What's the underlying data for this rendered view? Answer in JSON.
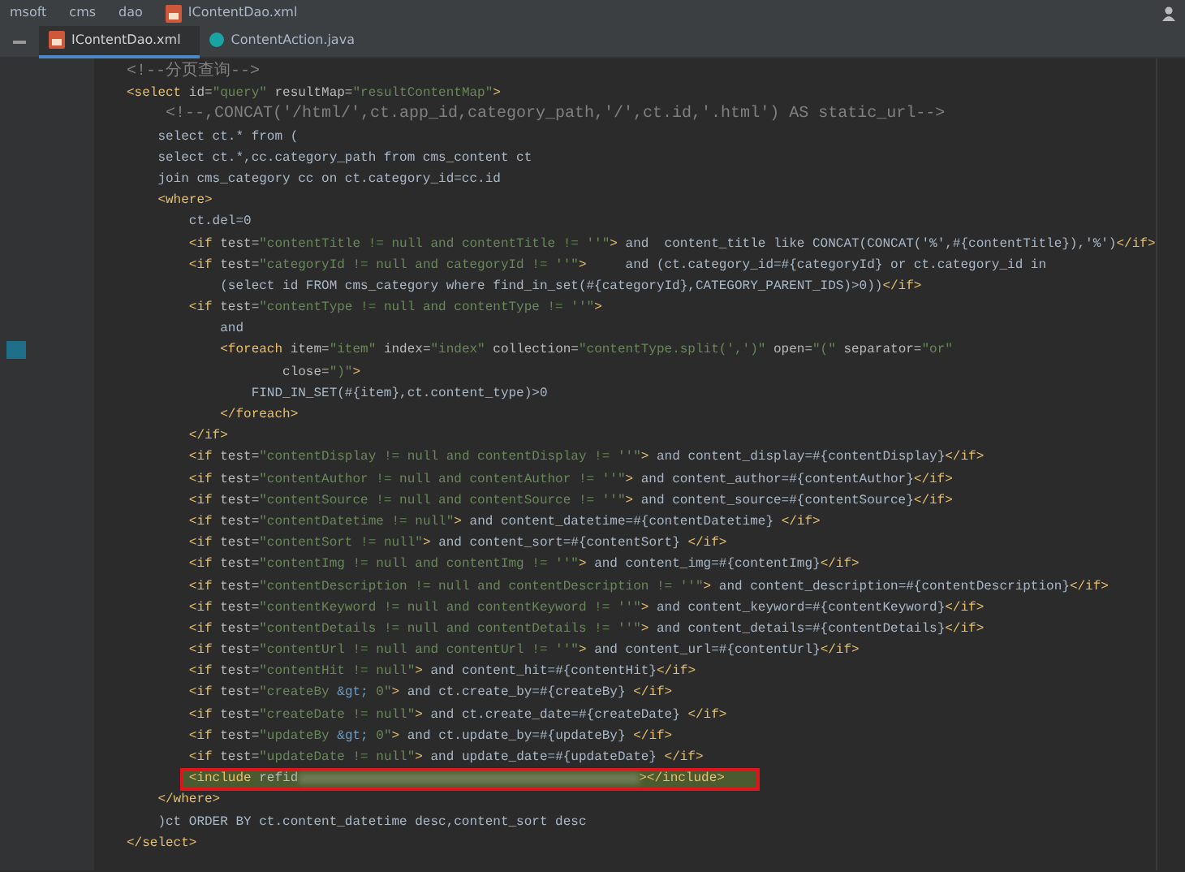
{
  "breadcrumb": [
    {
      "label": "msoft",
      "kind": "folder"
    },
    {
      "label": "cms",
      "kind": "folder"
    },
    {
      "label": "dao",
      "kind": "folder"
    },
    {
      "label": "IContentDao.xml",
      "kind": "file"
    }
  ],
  "tabs": [
    {
      "label": "IContentDao.xml",
      "kind": "xml",
      "selected": true
    },
    {
      "label": "ContentAction.java",
      "kind": "java",
      "selected": false
    }
  ],
  "code_lines": [
    {
      "highlighted": false,
      "marked": false,
      "tokens": [
        {
          "kind": "comment",
          "text": "<!--分页查询-->"
        }
      ]
    },
    {
      "highlighted": false,
      "marked": false,
      "tokens": [
        {
          "kind": "tag",
          "text": "<select"
        },
        {
          "kind": "attr",
          "text": " id="
        },
        {
          "kind": "str",
          "text": "\"query\""
        },
        {
          "kind": "attr",
          "text": " resultMap="
        },
        {
          "kind": "str",
          "text": "\"resultContentMap\""
        },
        {
          "kind": "tag",
          "text": ">"
        }
      ]
    },
    {
      "highlighted": false,
      "marked": false,
      "tokens": [
        {
          "kind": "comment",
          "text": "    <!--,CONCAT('/html/',ct.app_id,category_path,'/',ct.id,'.html') AS static_url-->"
        }
      ]
    },
    {
      "highlighted": false,
      "marked": false,
      "tokens": [
        {
          "kind": "text",
          "text": "    select ct.* from ("
        }
      ]
    },
    {
      "highlighted": false,
      "marked": false,
      "tokens": [
        {
          "kind": "text",
          "text": "    select ct.*,cc.category_path from cms_content ct"
        }
      ]
    },
    {
      "highlighted": false,
      "marked": false,
      "tokens": [
        {
          "kind": "text",
          "text": "    join cms_category cc on ct.category_id=cc.id"
        }
      ]
    },
    {
      "highlighted": false,
      "marked": false,
      "tokens": [
        {
          "kind": "tag",
          "text": "    <where>"
        }
      ]
    },
    {
      "highlighted": false,
      "marked": false,
      "tokens": [
        {
          "kind": "text",
          "text": "        ct.del=0"
        }
      ]
    },
    {
      "highlighted": false,
      "marked": false,
      "tokens": [
        {
          "kind": "tag",
          "text": "        <if"
        },
        {
          "kind": "attr",
          "text": " test="
        },
        {
          "kind": "str",
          "text": "\"contentTitle != null and contentTitle != ''\""
        },
        {
          "kind": "tag",
          "text": ">"
        },
        {
          "kind": "text",
          "text": " and  content_title like CONCAT(CONCAT('%',#{contentTitle}),'%')"
        },
        {
          "kind": "tag",
          "text": "</if>"
        }
      ]
    },
    {
      "highlighted": false,
      "marked": false,
      "tokens": [
        {
          "kind": "tag",
          "text": "        <if"
        },
        {
          "kind": "attr",
          "text": " test="
        },
        {
          "kind": "str",
          "text": "\"categoryId != null and categoryId != ''\""
        },
        {
          "kind": "tag",
          "text": ">"
        },
        {
          "kind": "text",
          "text": "     and (ct.category_id=#{categoryId} or ct.category_id in"
        }
      ]
    },
    {
      "highlighted": false,
      "marked": false,
      "tokens": [
        {
          "kind": "text",
          "text": "            (select id FROM cms_category where find_in_set(#{categoryId},CATEGORY_PARENT_IDS)>0))"
        },
        {
          "kind": "tag",
          "text": "</if>"
        }
      ]
    },
    {
      "highlighted": false,
      "marked": false,
      "tokens": [
        {
          "kind": "tag",
          "text": "        <if"
        },
        {
          "kind": "attr",
          "text": " test="
        },
        {
          "kind": "str",
          "text": "\"contentType != null and contentType != ''\""
        },
        {
          "kind": "tag",
          "text": ">"
        }
      ]
    },
    {
      "highlighted": false,
      "marked": false,
      "tokens": [
        {
          "kind": "text",
          "text": "            and"
        }
      ]
    },
    {
      "highlighted": false,
      "marked": true,
      "tokens": [
        {
          "kind": "tag",
          "text": "            <foreach"
        },
        {
          "kind": "attr",
          "text": " item="
        },
        {
          "kind": "str",
          "text": "\"item\""
        },
        {
          "kind": "attr",
          "text": " index="
        },
        {
          "kind": "str",
          "text": "\"index\""
        },
        {
          "kind": "attr",
          "text": " collection="
        },
        {
          "kind": "str",
          "text": "\"contentType.split(',')\""
        },
        {
          "kind": "attr",
          "text": " open="
        },
        {
          "kind": "str",
          "text": "\"(\""
        },
        {
          "kind": "attr",
          "text": " separator="
        },
        {
          "kind": "str",
          "text": "\"or\""
        }
      ]
    },
    {
      "highlighted": false,
      "marked": false,
      "tokens": [
        {
          "kind": "attr",
          "text": "                    close="
        },
        {
          "kind": "str",
          "text": "\")\""
        },
        {
          "kind": "tag",
          "text": ">"
        }
      ]
    },
    {
      "highlighted": false,
      "marked": false,
      "tokens": [
        {
          "kind": "text",
          "text": "                FIND_IN_SET(#{item},ct.content_type)>0"
        }
      ]
    },
    {
      "highlighted": false,
      "marked": false,
      "tokens": [
        {
          "kind": "tag",
          "text": "            </foreach>"
        }
      ]
    },
    {
      "highlighted": false,
      "marked": false,
      "tokens": [
        {
          "kind": "tag",
          "text": "        </if>"
        }
      ]
    },
    {
      "highlighted": false,
      "marked": false,
      "tokens": [
        {
          "kind": "tag",
          "text": "        <if"
        },
        {
          "kind": "attr",
          "text": " test="
        },
        {
          "kind": "str",
          "text": "\"contentDisplay != null and contentDisplay != ''\""
        },
        {
          "kind": "tag",
          "text": ">"
        },
        {
          "kind": "text",
          "text": " and content_display=#{contentDisplay}"
        },
        {
          "kind": "tag",
          "text": "</if>"
        }
      ]
    },
    {
      "highlighted": false,
      "marked": false,
      "tokens": [
        {
          "kind": "tag",
          "text": "        <if"
        },
        {
          "kind": "attr",
          "text": " test="
        },
        {
          "kind": "str",
          "text": "\"contentAuthor != null and contentAuthor != ''\""
        },
        {
          "kind": "tag",
          "text": ">"
        },
        {
          "kind": "text",
          "text": " and content_author=#{contentAuthor}"
        },
        {
          "kind": "tag",
          "text": "</if>"
        }
      ]
    },
    {
      "highlighted": false,
      "marked": false,
      "tokens": [
        {
          "kind": "tag",
          "text": "        <if"
        },
        {
          "kind": "attr",
          "text": " test="
        },
        {
          "kind": "str",
          "text": "\"contentSource != null and contentSource != ''\""
        },
        {
          "kind": "tag",
          "text": ">"
        },
        {
          "kind": "text",
          "text": " and content_source=#{contentSource}"
        },
        {
          "kind": "tag",
          "text": "</if>"
        }
      ]
    },
    {
      "highlighted": false,
      "marked": false,
      "tokens": [
        {
          "kind": "tag",
          "text": "        <if"
        },
        {
          "kind": "attr",
          "text": " test="
        },
        {
          "kind": "str",
          "text": "\"contentDatetime != null\""
        },
        {
          "kind": "tag",
          "text": ">"
        },
        {
          "kind": "text",
          "text": " and content_datetime=#{contentDatetime} "
        },
        {
          "kind": "tag",
          "text": "</if>"
        }
      ]
    },
    {
      "highlighted": false,
      "marked": false,
      "tokens": [
        {
          "kind": "tag",
          "text": "        <if"
        },
        {
          "kind": "attr",
          "text": " test="
        },
        {
          "kind": "str",
          "text": "\"contentSort != null\""
        },
        {
          "kind": "tag",
          "text": ">"
        },
        {
          "kind": "text",
          "text": " and content_sort=#{contentSort} "
        },
        {
          "kind": "tag",
          "text": "</if>"
        }
      ]
    },
    {
      "highlighted": false,
      "marked": false,
      "tokens": [
        {
          "kind": "tag",
          "text": "        <if"
        },
        {
          "kind": "attr",
          "text": " test="
        },
        {
          "kind": "str",
          "text": "\"contentImg != null and contentImg != ''\""
        },
        {
          "kind": "tag",
          "text": ">"
        },
        {
          "kind": "text",
          "text": " and content_img=#{contentImg}"
        },
        {
          "kind": "tag",
          "text": "</if>"
        }
      ]
    },
    {
      "highlighted": false,
      "marked": false,
      "tokens": [
        {
          "kind": "tag",
          "text": "        <if"
        },
        {
          "kind": "attr",
          "text": " test="
        },
        {
          "kind": "str",
          "text": "\"contentDescription != null and contentDescription != ''\""
        },
        {
          "kind": "tag",
          "text": ">"
        },
        {
          "kind": "text",
          "text": " and content_description=#{contentDescription}"
        },
        {
          "kind": "tag",
          "text": "</if>"
        }
      ]
    },
    {
      "highlighted": false,
      "marked": false,
      "tokens": [
        {
          "kind": "tag",
          "text": "        <if"
        },
        {
          "kind": "attr",
          "text": " test="
        },
        {
          "kind": "str",
          "text": "\"contentKeyword != null and contentKeyword != ''\""
        },
        {
          "kind": "tag",
          "text": ">"
        },
        {
          "kind": "text",
          "text": " and content_keyword=#{contentKeyword}"
        },
        {
          "kind": "tag",
          "text": "</if>"
        }
      ]
    },
    {
      "highlighted": false,
      "marked": false,
      "tokens": [
        {
          "kind": "tag",
          "text": "        <if"
        },
        {
          "kind": "attr",
          "text": " test="
        },
        {
          "kind": "str",
          "text": "\"contentDetails != null and contentDetails != ''\""
        },
        {
          "kind": "tag",
          "text": ">"
        },
        {
          "kind": "text",
          "text": " and content_details=#{contentDetails}"
        },
        {
          "kind": "tag",
          "text": "</if>"
        }
      ]
    },
    {
      "highlighted": false,
      "marked": false,
      "tokens": [
        {
          "kind": "tag",
          "text": "        <if"
        },
        {
          "kind": "attr",
          "text": " test="
        },
        {
          "kind": "str",
          "text": "\"contentUrl != null and contentUrl != ''\""
        },
        {
          "kind": "tag",
          "text": ">"
        },
        {
          "kind": "text",
          "text": " and content_url=#{contentUrl}"
        },
        {
          "kind": "tag",
          "text": "</if>"
        }
      ]
    },
    {
      "highlighted": false,
      "marked": false,
      "tokens": [
        {
          "kind": "tag",
          "text": "        <if"
        },
        {
          "kind": "attr",
          "text": " test="
        },
        {
          "kind": "str",
          "text": "\"contentHit != null\""
        },
        {
          "kind": "tag",
          "text": ">"
        },
        {
          "kind": "text",
          "text": " and content_hit=#{contentHit}"
        },
        {
          "kind": "tag",
          "text": "</if>"
        }
      ]
    },
    {
      "highlighted": false,
      "marked": false,
      "tokens": [
        {
          "kind": "tag",
          "text": "        <if"
        },
        {
          "kind": "attr",
          "text": " test="
        },
        {
          "kind": "str",
          "text": "\"createBy "
        },
        {
          "kind": "entity",
          "text": "&gt;"
        },
        {
          "kind": "str",
          "text": " 0\""
        },
        {
          "kind": "tag",
          "text": ">"
        },
        {
          "kind": "text",
          "text": " and ct.create_by=#{createBy} "
        },
        {
          "kind": "tag",
          "text": "</if>"
        }
      ]
    },
    {
      "highlighted": false,
      "marked": false,
      "tokens": [
        {
          "kind": "tag",
          "text": "        <if"
        },
        {
          "kind": "attr",
          "text": " test="
        },
        {
          "kind": "str",
          "text": "\"createDate != null\""
        },
        {
          "kind": "tag",
          "text": ">"
        },
        {
          "kind": "text",
          "text": " and ct.create_date=#{createDate} "
        },
        {
          "kind": "tag",
          "text": "</if>"
        }
      ]
    },
    {
      "highlighted": false,
      "marked": false,
      "tokens": [
        {
          "kind": "tag",
          "text": "        <if"
        },
        {
          "kind": "attr",
          "text": " test="
        },
        {
          "kind": "str",
          "text": "\"updateBy "
        },
        {
          "kind": "entity",
          "text": "&gt;"
        },
        {
          "kind": "str",
          "text": " 0\""
        },
        {
          "kind": "tag",
          "text": ">"
        },
        {
          "kind": "text",
          "text": " and ct.update_by=#{updateBy} "
        },
        {
          "kind": "tag",
          "text": "</if>"
        }
      ]
    },
    {
      "highlighted": false,
      "marked": false,
      "tokens": [
        {
          "kind": "tag",
          "text": "        <if"
        },
        {
          "kind": "attr",
          "text": " test="
        },
        {
          "kind": "str",
          "text": "\"updateDate != null\""
        },
        {
          "kind": "tag",
          "text": ">"
        },
        {
          "kind": "text",
          "text": " and update_date=#{updateDate} "
        },
        {
          "kind": "tag",
          "text": "</if>"
        }
      ]
    },
    {
      "highlighted": true,
      "marked": false,
      "tokens": [
        {
          "kind": "tag",
          "text": "        <include"
        },
        {
          "kind": "attr",
          "text": " refid"
        },
        {
          "kind": "blur"
        },
        {
          "kind": "tag",
          "text": "></include>"
        }
      ]
    },
    {
      "highlighted": false,
      "marked": false,
      "tokens": [
        {
          "kind": "tag",
          "text": "    </where>"
        }
      ]
    },
    {
      "highlighted": false,
      "marked": false,
      "tokens": [
        {
          "kind": "text",
          "text": "    )ct ORDER BY ct.content_datetime desc,content_sort desc"
        }
      ]
    },
    {
      "highlighted": false,
      "marked": false,
      "tokens": [
        {
          "kind": "tag",
          "text": "</select>"
        }
      ]
    }
  ]
}
